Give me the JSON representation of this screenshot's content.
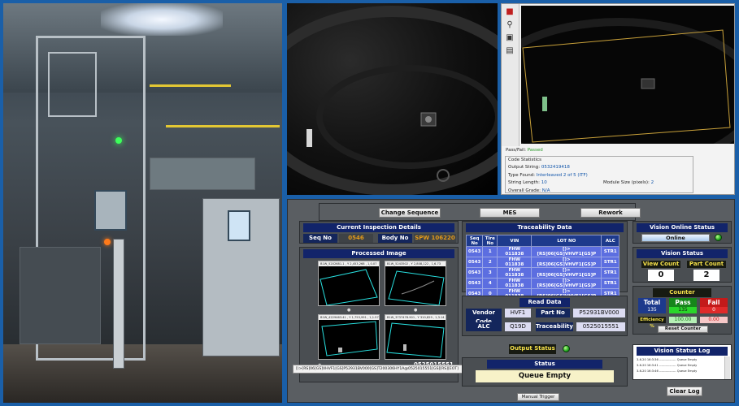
{
  "reader": {
    "tool_icons": [
      "camera-icon",
      "zoom-icon",
      "image-icon",
      "save-icon"
    ],
    "pass_fail_label": "Pass/Fail:",
    "pass_fail_value": "Passed",
    "code_statistics": "Code Statistics",
    "output_string_label": "Output String:",
    "output_string_value": "0532419418",
    "type_found_label": "Type Found:",
    "type_found_value": "Interleaved 2 of 5 (ITF)",
    "string_length_label": "String Length:",
    "string_length_value": "10",
    "module_size_label": "Module Size (pixels):",
    "module_size_value": "2",
    "overall_grade_label": "Overall Grade:",
    "overall_grade_value": "N/A"
  },
  "hmi": {
    "top_buttons": [
      "Change Sequence",
      "MES",
      "Rework"
    ],
    "inspection": {
      "title": "Current Inspection Details",
      "seq_label": "Seq No",
      "seq_value": "0546",
      "body_label": "Body No",
      "body_value": "SPW 106220"
    },
    "processed": {
      "title": "Processed Image",
      "thumb_headers": [
        "B1W_5202681.1 , Y 2,453,268 , 1,0.07",
        "B1W_5243502 , Y 2,808,122 , 1,6.73",
        "B1W_4229463.41 , Y 1,753,991 , 1,1.57",
        "B1W_3737478.901 , Y 310,829 , 1,3.14"
      ],
      "caption": "0525015551"
    },
    "trace": {
      "title": "Traceability Data",
      "headers": [
        "Seq No",
        "Tire No",
        "VIN",
        "LOT NO",
        "ALC"
      ],
      "rows": [
        [
          "0543",
          "1",
          "FHW 011838",
          "[)>[RS]06[GS]VHVF1[GS]P",
          "STR1"
        ],
        [
          "0543",
          "2",
          "FHW 011838",
          "[)>[RS]06[GS]VHVF1[GS]P",
          "STR1"
        ],
        [
          "0543",
          "3",
          "FHW 011838",
          "[)>[RS]06[GS]VHVF1[GS]P",
          "STR1"
        ],
        [
          "0543",
          "4",
          "FHW 011838",
          "[)>[RS]06[GS]VHVF1[GS]P",
          "STR1"
        ],
        [
          "0543",
          "0",
          "FHW 011838",
          "[)>[RS]06[GS]VHVF1[GS]P",
          "STR1"
        ]
      ]
    },
    "read_data": {
      "title": "Read Data",
      "vendor_label": "Vendor Code",
      "vendor_value": "HVF1",
      "part_label": "Part No",
      "part_value": "P52931BV000",
      "alc_label": "ALC",
      "alc_value": "Q19D",
      "trace_label": "Traceability",
      "trace_value": "0525015551"
    },
    "output_status_label": "Output Status",
    "status": {
      "title": "Status",
      "value": "Queue Empty"
    },
    "barcode_string": "[)>[RS]06[GS]VHVF1[GS]P52931BV000[GS]T200306HY1A@0525015551[GS][RS][EOT]",
    "manual_trigger": "Manual Trigger",
    "vision_online": {
      "title": "Vision Online Status",
      "value": "Online"
    },
    "vision_status": {
      "title": "Vision Status",
      "view_label": "View Count",
      "view_value": "0",
      "part_label": "Part Count",
      "part_value": "2"
    },
    "counter": {
      "title": "Counter",
      "total_label": "Total",
      "pass_label": "Pass",
      "fail_label": "Fail",
      "total_value": "135",
      "pass_value": "135",
      "fail_value": "0",
      "efficiency_label": "Efficiency %",
      "efficiency_value": "100.00",
      "fail_pct_value": "0.00",
      "reset_label": "Reset Counter"
    },
    "log": {
      "title": "Vision Status Log",
      "entries": [
        "3-6-20 16:3:36 ---------------- Queue Empty",
        "3-6-20 16:3:41 ---------------- Queue Empty",
        "3-6-20 16:3:46 ---------------- Queue Empty"
      ],
      "clear_label": "Clear Log"
    }
  },
  "colors": {
    "background": "#1a5fa8",
    "hmi_title": "#12246a",
    "table_cell": "#5c6ee0",
    "online_led": "#1fa81f",
    "status_value_bg": "#f7f2c8"
  }
}
